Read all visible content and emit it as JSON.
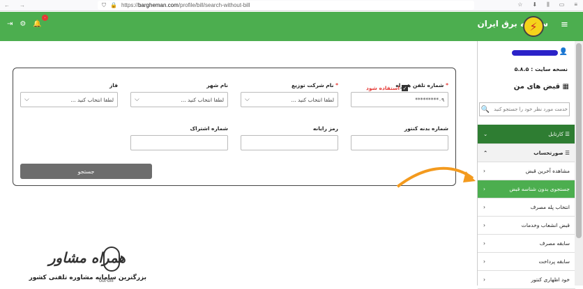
{
  "browser": {
    "url_prefix": "https://",
    "url_host": "bargheman.com",
    "url_path": "/profile/bill/search-without-bill"
  },
  "app": {
    "title": "سامانه برق ایران",
    "notif_count": "۰"
  },
  "sidebar": {
    "version_label": "نسخه سایت : ۵.۸.۵",
    "bills_label": "قبض های من",
    "search_placeholder": "خدمت مورد نظر خود را جستجو کنید",
    "items": [
      {
        "label": "کارتابل",
        "kind": "dark"
      },
      {
        "label": "صورتحساب",
        "kind": "hdr"
      },
      {
        "label": "مشاهده آخرین قبض",
        "kind": "item"
      },
      {
        "label": "جستجوی بدون شناسه قبض",
        "kind": "active"
      },
      {
        "label": "انتخاب پله مصرف",
        "kind": "item"
      },
      {
        "label": "قبض انشعاب وخدمات",
        "kind": "item"
      },
      {
        "label": "سابقه مصرف",
        "kind": "item"
      },
      {
        "label": "سابقه پرداخت",
        "kind": "item"
      },
      {
        "label": "خود اظهاری کنتور",
        "kind": "item"
      }
    ]
  },
  "form": {
    "phone_label": "شماره تلفن همراه",
    "phone_value": "۰۹*********",
    "use_label": "استفاده شود",
    "company_label": "نام شرکت توزیع",
    "city_label": "نام شهر",
    "phase_label": "فاز",
    "select_placeholder": "لطفا انتخاب کنید ...",
    "meter_label": "شماره بدنه کنتور",
    "code_label": "رمز رایانه",
    "subscription_label": "شماره اشتراک",
    "search_button": "جستجو"
  },
  "watermark": {
    "title": "همراه مشاور",
    "subtitle": "بزرگترین سامانه مشاوره تلفنی کشور"
  },
  "status_url": "out-bill"
}
